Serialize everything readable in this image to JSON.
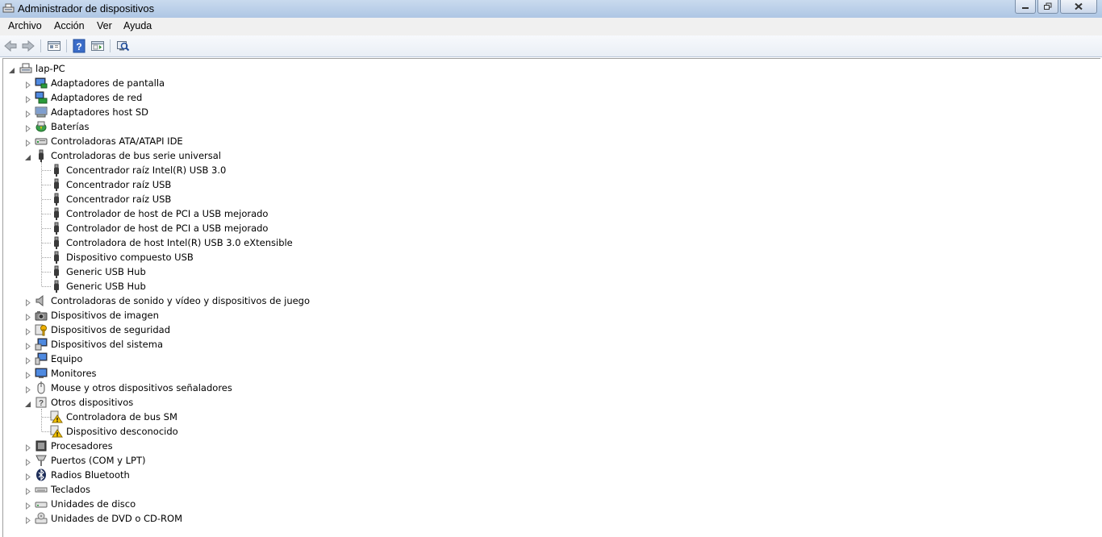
{
  "window": {
    "title": "Administrador de dispositivos"
  },
  "menu": {
    "items": [
      "Archivo",
      "Acción",
      "Ver",
      "Ayuda"
    ]
  },
  "toolbar": {
    "buttons": [
      "back-arrow-icon",
      "forward-arrow-icon",
      "properties-icon",
      "help-icon",
      "show-hide-tree-icon",
      "scan-hardware-icon"
    ]
  },
  "tree": {
    "root": "lap-PC",
    "categories": [
      {
        "label": "Adaptadores de pantalla",
        "icon": "display-adapter-icon",
        "expanded": false
      },
      {
        "label": "Adaptadores de red",
        "icon": "network-adapter-icon",
        "expanded": false
      },
      {
        "label": "Adaptadores host SD",
        "icon": "sd-host-icon",
        "expanded": false
      },
      {
        "label": "Baterías",
        "icon": "battery-icon",
        "expanded": false
      },
      {
        "label": "Controladoras ATA/ATAPI IDE",
        "icon": "ide-controller-icon",
        "expanded": false
      },
      {
        "label": "Controladoras de bus serie universal",
        "icon": "usb-icon",
        "expanded": true,
        "children": [
          {
            "label": "Concentrador raíz Intel(R) USB 3.0",
            "icon": "usb-icon"
          },
          {
            "label": "Concentrador raíz USB",
            "icon": "usb-icon"
          },
          {
            "label": "Concentrador raíz USB",
            "icon": "usb-icon"
          },
          {
            "label": "Controlador de host de PCI a USB mejorado",
            "icon": "usb-icon"
          },
          {
            "label": "Controlador de host de PCI a USB mejorado",
            "icon": "usb-icon"
          },
          {
            "label": "Controladora de host Intel(R) USB 3.0 eXtensible",
            "icon": "usb-icon"
          },
          {
            "label": "Dispositivo compuesto USB",
            "icon": "usb-icon"
          },
          {
            "label": "Generic USB Hub",
            "icon": "usb-icon"
          },
          {
            "label": "Generic USB Hub",
            "icon": "usb-icon"
          }
        ]
      },
      {
        "label": "Controladoras de sonido y vídeo y dispositivos de juego",
        "icon": "speaker-icon",
        "expanded": false
      },
      {
        "label": "Dispositivos de imagen",
        "icon": "camera-icon",
        "expanded": false
      },
      {
        "label": "Dispositivos de seguridad",
        "icon": "security-key-icon",
        "expanded": false
      },
      {
        "label": "Dispositivos del sistema",
        "icon": "system-device-icon",
        "expanded": false
      },
      {
        "label": "Equipo",
        "icon": "computer-icon",
        "expanded": false
      },
      {
        "label": "Monitores",
        "icon": "monitor-icon",
        "expanded": false
      },
      {
        "label": "Mouse y otros dispositivos señaladores",
        "icon": "mouse-icon",
        "expanded": false
      },
      {
        "label": "Otros dispositivos",
        "icon": "unknown-device-icon",
        "expanded": true,
        "children": [
          {
            "label": "Controladora de bus SM",
            "icon": "warning-device-icon"
          },
          {
            "label": "Dispositivo desconocido",
            "icon": "warning-device-icon"
          }
        ]
      },
      {
        "label": "Procesadores",
        "icon": "processor-icon",
        "expanded": false
      },
      {
        "label": "Puertos (COM y LPT)",
        "icon": "port-icon",
        "expanded": false
      },
      {
        "label": "Radios Bluetooth",
        "icon": "bluetooth-icon",
        "expanded": false
      },
      {
        "label": "Teclados",
        "icon": "keyboard-icon",
        "expanded": false
      },
      {
        "label": "Unidades de disco",
        "icon": "disk-drive-icon",
        "expanded": false
      },
      {
        "label": "Unidades de DVD o CD-ROM",
        "icon": "dvd-drive-icon",
        "expanded": false
      }
    ]
  },
  "colors": {
    "titlebar": "#aec6e4",
    "usb_icon": "#3a3a3a",
    "warning": "#f5c400"
  }
}
